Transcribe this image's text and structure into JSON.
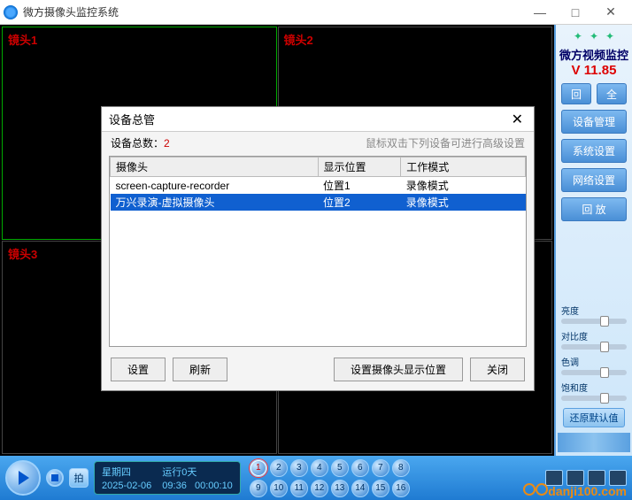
{
  "titlebar": {
    "title": "微方摄像头监控系统"
  },
  "cameras": {
    "c1": "镜头1",
    "c2": "镜头2",
    "c3": "镜头3",
    "c4": ""
  },
  "sidebar": {
    "brand": "微方视频监控",
    "version": "V 11.85",
    "btn_rec": "回",
    "btn_all": "全",
    "btn_device": "设备管理",
    "btn_system": "系统设置",
    "btn_network": "网络设置",
    "btn_playback": "回  放",
    "sliders": {
      "bright": "亮度",
      "contrast": "对比度",
      "hue": "色调",
      "saturation": "饱和度"
    },
    "reset": "还原默认值"
  },
  "bottom": {
    "snap": "拍",
    "status": {
      "day": "星期四",
      "runtime": "运行0天",
      "date": "2025-02-06",
      "time1": "09:36",
      "time2": "00:00:10"
    },
    "watermark": "danji100.com"
  },
  "modal": {
    "title": "设备总管",
    "count_label": "设备总数：",
    "count_value": "2",
    "hint": "鼠标双击下列设备可进行高级设置",
    "headers": {
      "cam": "摄像头",
      "pos": "显示位置",
      "mode": "工作模式"
    },
    "rows": [
      {
        "cam": "screen-capture-recorder",
        "pos": "位置1",
        "mode": "录像模式"
      },
      {
        "cam": "万兴录演-虚拟摄像头",
        "pos": "位置2",
        "mode": "录像模式"
      }
    ],
    "btn_set": "设置",
    "btn_refresh": "刷新",
    "btn_pos": "设置摄像头显示位置",
    "btn_close": "关闭"
  }
}
